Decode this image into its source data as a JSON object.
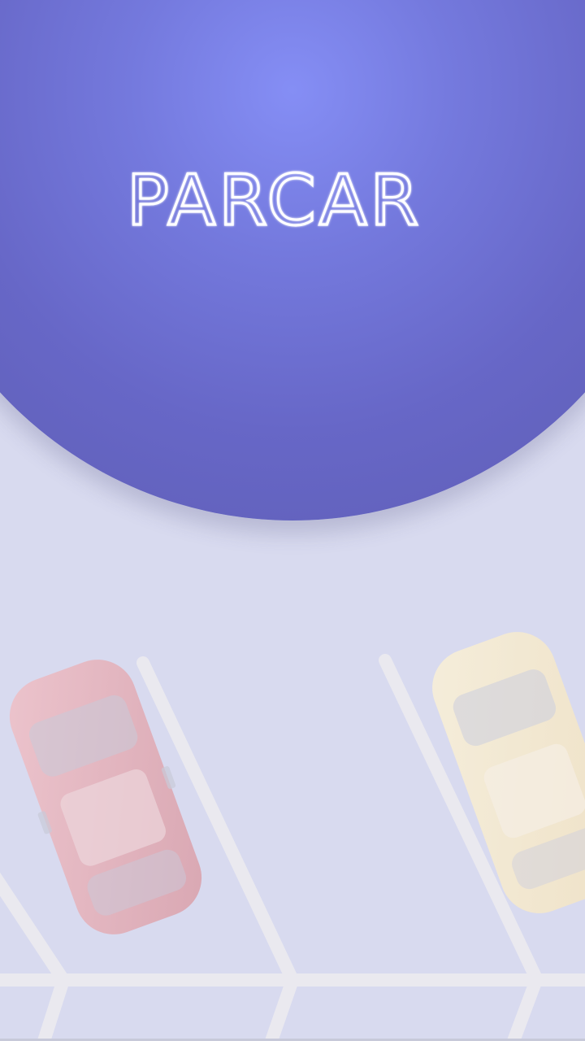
{
  "app": {
    "name": "PARCAR"
  },
  "colors": {
    "hero_light": "#858ef5",
    "hero_dark": "#5d5cb1",
    "background": "#d9dbee",
    "lane_lines": "#ebeaf0"
  }
}
